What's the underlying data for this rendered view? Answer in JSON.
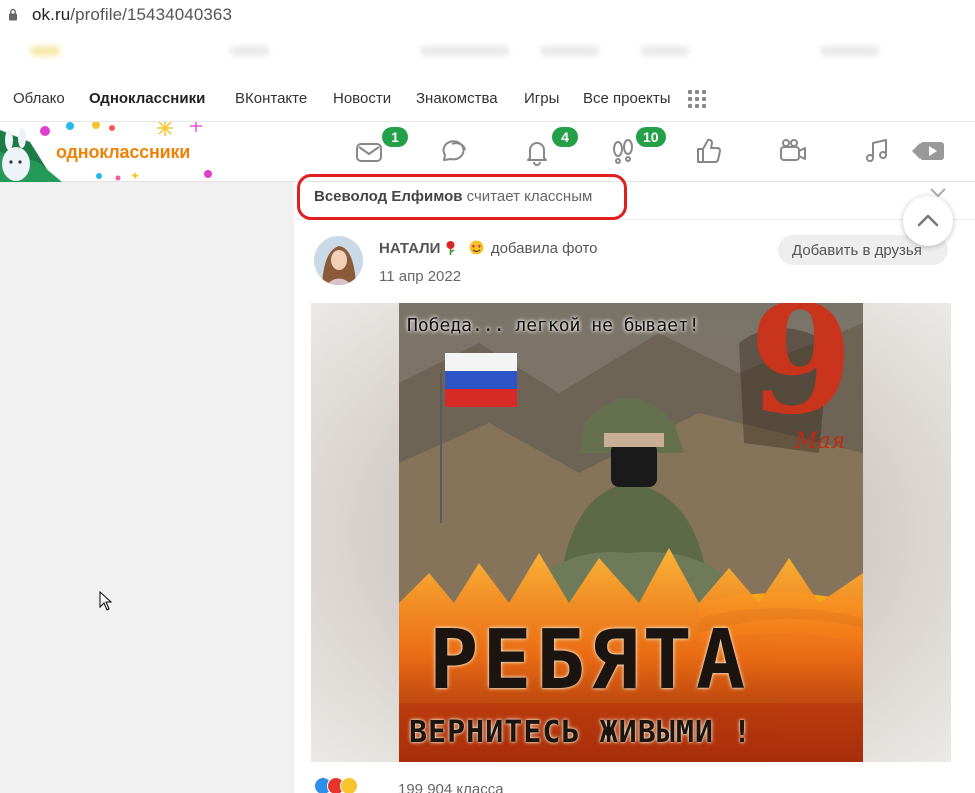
{
  "browser": {
    "url_host": "ok.ru",
    "url_path": "/profile/15434040363"
  },
  "portal_nav": {
    "items": [
      {
        "label": "Облако"
      },
      {
        "label": "Одноклассники",
        "active": true
      },
      {
        "label": "ВКонтакте"
      },
      {
        "label": "Новости"
      },
      {
        "label": "Знакомства"
      },
      {
        "label": "Игры"
      },
      {
        "label": "Все проекты"
      }
    ],
    "apps_icon": "grid-icon"
  },
  "toolbar": {
    "logo_text": "одноклассники",
    "icons": [
      {
        "name": "messages-icon",
        "badge": "1"
      },
      {
        "name": "discussions-icon",
        "badge": ""
      },
      {
        "name": "notifications-icon",
        "badge": "4"
      },
      {
        "name": "guests-icon",
        "badge": "10"
      },
      {
        "name": "likes-icon",
        "badge": ""
      },
      {
        "name": "video-icon",
        "badge": ""
      },
      {
        "name": "music-icon",
        "badge": ""
      },
      {
        "name": "video-player-icon",
        "badge": ""
      }
    ],
    "badge_color": "#24a148",
    "logo_color": "#ee8208"
  },
  "post": {
    "reason_name": "Всеволод Елфимов",
    "reason_action": "считает классным",
    "author_name": "НАТАЛИ",
    "author_action": "добавила фото",
    "date": "11 апр 2022",
    "add_friend_label": "Добавить в друзья",
    "photo_text": {
      "top": "Победа... легкой не бывает!",
      "nine": "9",
      "maya": "Мая",
      "big": "РЕБЯТА",
      "sub": "ВЕРНИТЕСЬ ЖИВЫМИ !"
    },
    "klass_count": "199 904 класса"
  },
  "colors": {
    "highlight_border": "#e02020",
    "page_bg": "#f1f1f1"
  }
}
